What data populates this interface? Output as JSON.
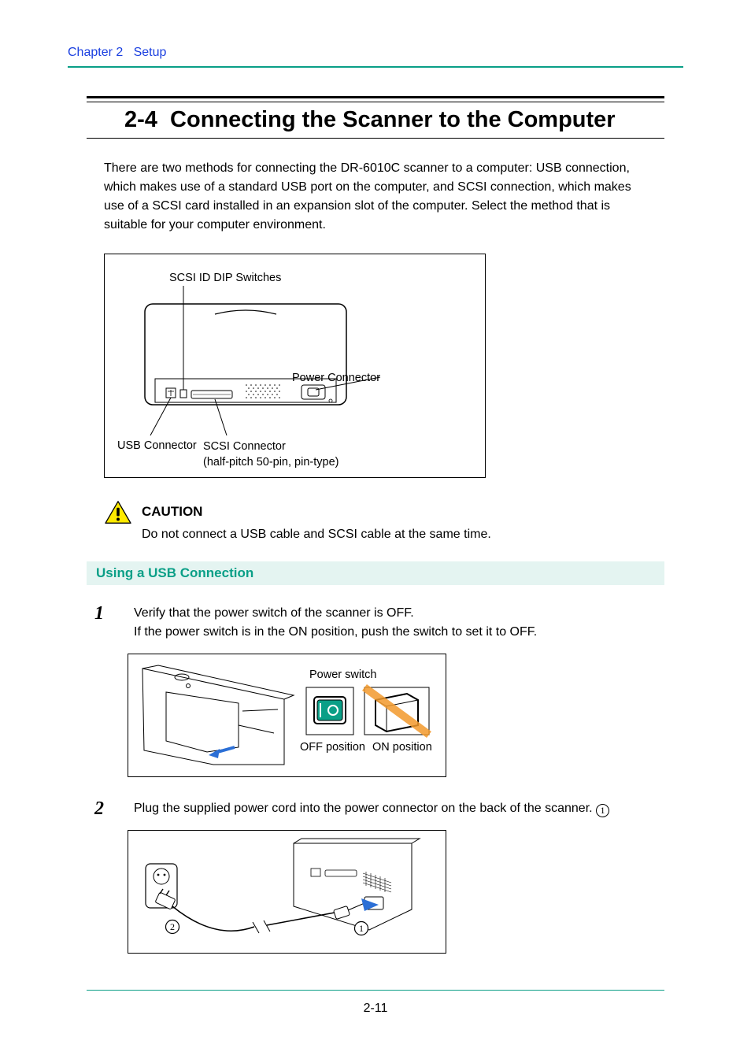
{
  "header": {
    "chapter": "Chapter 2",
    "title": "Setup"
  },
  "h1": {
    "number": "2-4",
    "text": "Connecting the Scanner to the Computer"
  },
  "intro": "There are two methods for connecting the DR-6010C scanner to a computer: USB connection, which makes use of a standard USB port on the computer, and SCSI connection, which makes use of a SCSI card installed in an expansion slot of the computer. Select the method that is suitable for your computer environment.",
  "diagram1": {
    "dip_label": "SCSI ID DIP Switches",
    "power_label": "Power Connector",
    "usb_label": "USB Connector",
    "scsi_label_line1": "SCSI Connector",
    "scsi_label_line2": "(half-pitch 50-pin, pin-type)"
  },
  "caution": {
    "title": "CAUTION",
    "body": "Do not connect a USB cable and SCSI cable at the same time."
  },
  "h2": "Using a USB Connection",
  "step1": {
    "num": "1",
    "line1": "Verify that the power switch of the scanner is OFF.",
    "line2": "If the power switch is in the ON position, push the switch to set it to OFF."
  },
  "diagram2": {
    "switch_label": "Power switch",
    "off_label": "OFF position",
    "on_label": "ON position"
  },
  "step2": {
    "num": "2",
    "text": "Plug the supplied power cord into the power connector on the back of the scanner. ",
    "ref": "1"
  },
  "diagram3": {
    "ref_outlet": "2",
    "ref_scanner": "1"
  },
  "page_number": "2-11"
}
